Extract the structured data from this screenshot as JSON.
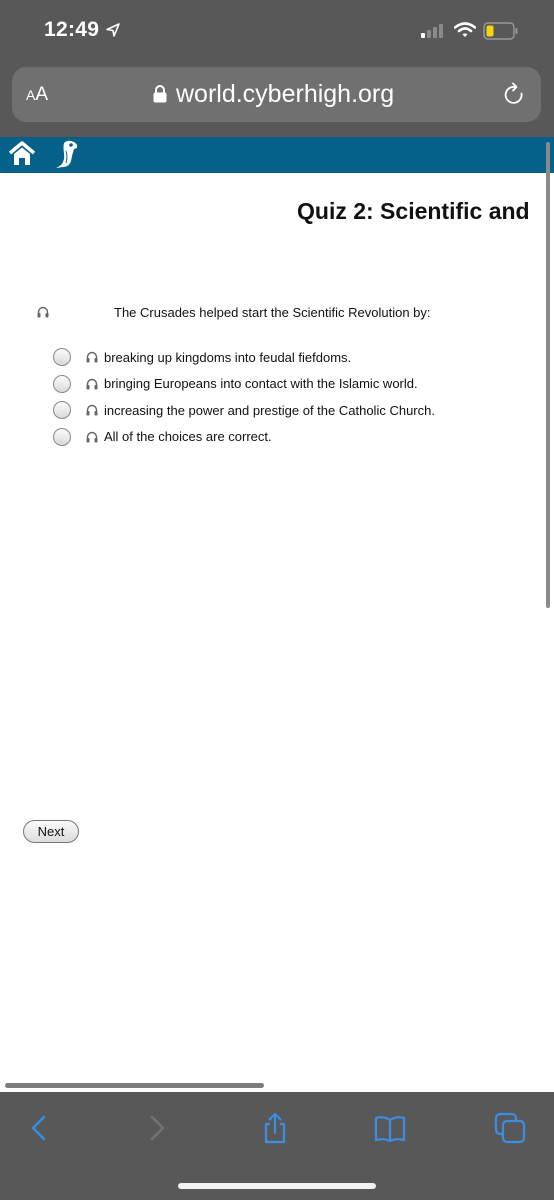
{
  "status_bar": {
    "time": "12:49",
    "battery_color": "#f5d50b"
  },
  "browser": {
    "text_size_label_small": "A",
    "text_size_label_large": "A",
    "url": "world.cyberhigh.org"
  },
  "site": {
    "header_color": "#03618a"
  },
  "quiz": {
    "title": "Quiz 2: Scientific and",
    "question": "The Crusades helped start the Scientific Revolution by:",
    "choices": [
      {
        "label": "breaking up kingdoms into feudal fiefdoms.",
        "selected": false
      },
      {
        "label": "bringing Europeans into contact with the Islamic world.",
        "selected": false
      },
      {
        "label": "increasing the power and prestige of the Catholic Church.",
        "selected": false
      },
      {
        "label": "All of the choices are correct.",
        "selected": false
      }
    ],
    "next_label": "Next"
  },
  "toolbar": {
    "accent_color": "#3a8ee6",
    "items": [
      "back",
      "forward",
      "share",
      "bookmarks",
      "tabs"
    ]
  }
}
